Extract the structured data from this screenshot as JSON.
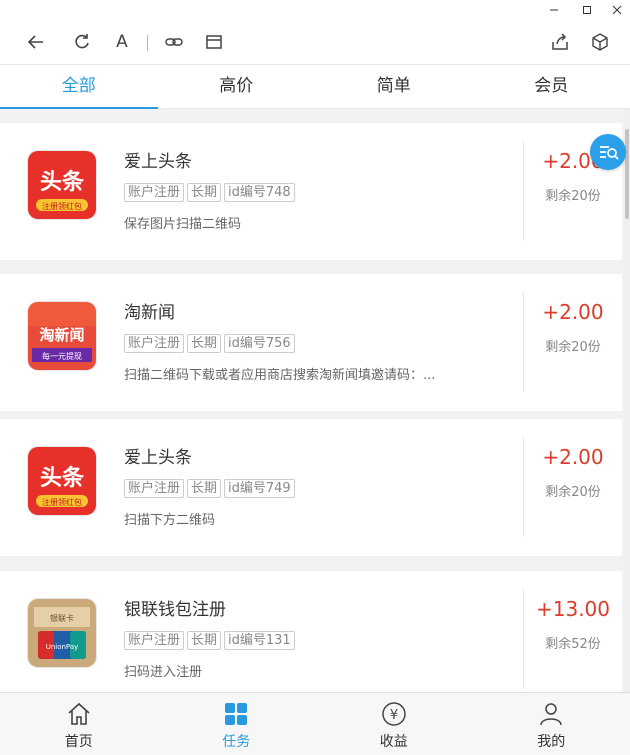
{
  "colors": {
    "accent": "#2a9ae0",
    "price": "#dd3b2b",
    "tag_border": "#cccccc"
  },
  "window": {
    "controls": [
      "minimize",
      "maximize",
      "close"
    ]
  },
  "toolbar": {
    "left_icons": [
      "back-arrow-icon",
      "refresh-icon",
      "font-icon",
      "link-icon",
      "window-icon"
    ],
    "font_glyph": "A",
    "right_icons": [
      "share-icon",
      "cube-icon"
    ]
  },
  "tabs": [
    {
      "label": "全部",
      "active": true
    },
    {
      "label": "高价",
      "active": false
    },
    {
      "label": "简单",
      "active": false
    },
    {
      "label": "会员",
      "active": false
    }
  ],
  "tasks": [
    {
      "title": "爱上头条",
      "tags": [
        "账户注册",
        "长期",
        "id编号748"
      ],
      "desc": "保存图片扫描二维码",
      "price": "+2.00",
      "remain": "剩余20份",
      "icon": "toutiao-icon",
      "icon_main": "头条",
      "icon_sub": "注册领红包"
    },
    {
      "title": "淘新闻",
      "tags": [
        "账户注册",
        "长期",
        "id编号756"
      ],
      "desc": "扫描二维码下载或者应用商店搜索淘新闻填邀请码：...",
      "price": "+2.00",
      "remain": "剩余20份",
      "icon": "taoxinwen-icon",
      "icon_main": "淘新闻",
      "icon_sub": "每一元提现"
    },
    {
      "title": "爱上头条",
      "tags": [
        "账户注册",
        "长期",
        "id编号749"
      ],
      "desc": "扫描下方二维码",
      "price": "+2.00",
      "remain": "剩余20份",
      "icon": "toutiao-icon",
      "icon_main": "头条",
      "icon_sub": "注册领红包"
    },
    {
      "title": "银联钱包注册",
      "tags": [
        "账户注册",
        "长期",
        "id编号131"
      ],
      "desc": "扫码进入注册",
      "price": "+13.00",
      "remain": "剩余52份",
      "icon": "unionpay-wallet-icon",
      "icon_main": "UnionPay",
      "icon_sub": "银联卡"
    }
  ],
  "bottom_nav": [
    {
      "label": "首页",
      "icon": "home-icon",
      "active": false
    },
    {
      "label": "任务",
      "icon": "grid-icon",
      "active": true
    },
    {
      "label": "收益",
      "icon": "yuan-icon",
      "active": false,
      "glyph": "¥"
    },
    {
      "label": "我的",
      "icon": "user-icon",
      "active": false
    }
  ]
}
